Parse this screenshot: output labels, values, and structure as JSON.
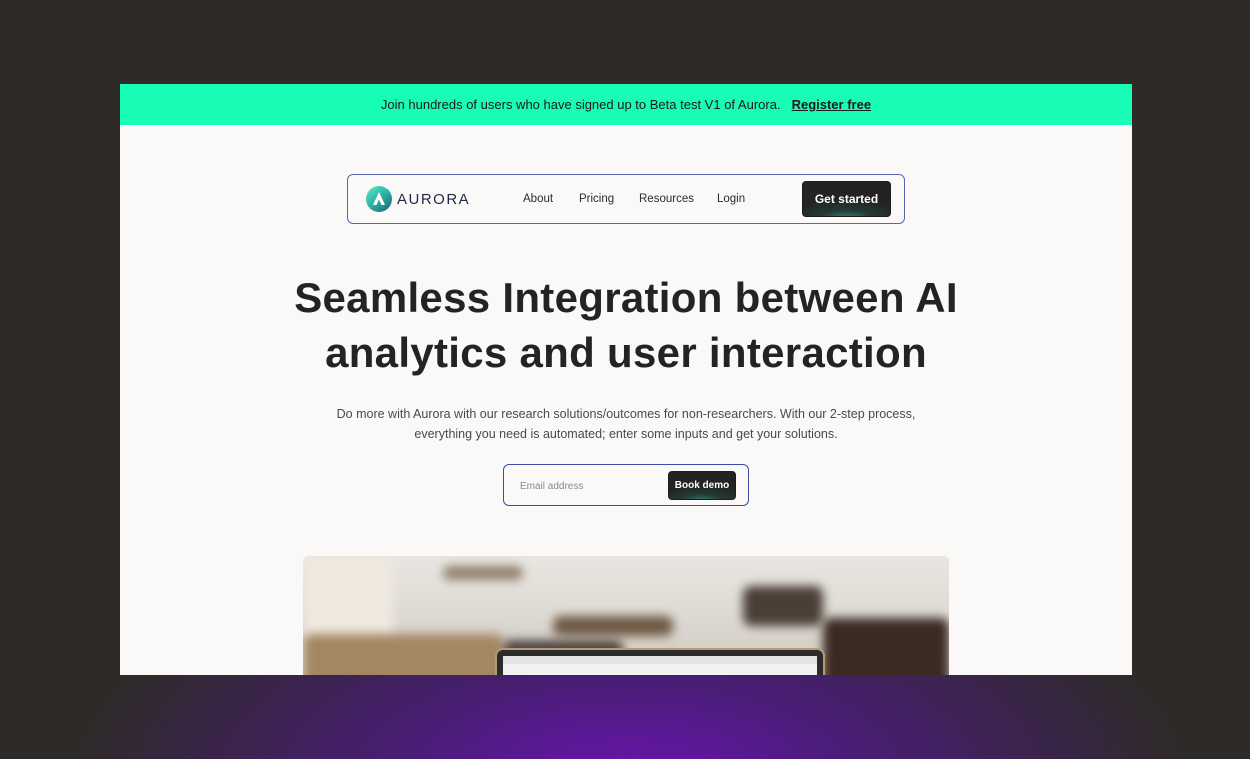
{
  "banner": {
    "message": "Join hundreds of users who have signed up to Beta test V1 of Aurora.",
    "link_label": "Register free",
    "background_color": "#17fdb5"
  },
  "nav": {
    "brand": "AURORA",
    "links": [
      "About",
      "Pricing",
      "Resources",
      "Login"
    ],
    "cta_label": "Get started"
  },
  "hero": {
    "headline_line1": "Seamless Integration between AI",
    "headline_line2": "analytics and user interaction",
    "subtext_line1": "Do more with Aurora with our research solutions/outcomes for non-researchers. With our 2-step process,",
    "subtext_line2": "everything you need is automated; enter some inputs and get your solutions.",
    "email_placeholder": "Email address",
    "demo_button_label": "Book demo"
  },
  "colors": {
    "page_background": "#2e2a28",
    "glow": "#6a14b0",
    "accent": "#17fdb5",
    "outline": "#3c4aa8"
  }
}
